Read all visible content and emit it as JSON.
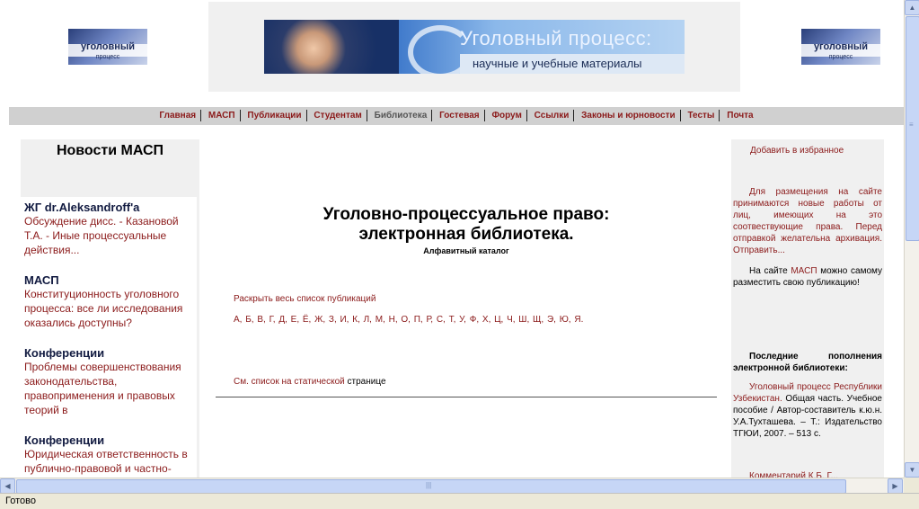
{
  "logo": {
    "text": "уголовный",
    "subtext": "процесс"
  },
  "banner": {
    "title": "Уголовный процесс:",
    "subtitle": "научные и учебные материалы"
  },
  "nav": {
    "items": [
      "Главная",
      "МАСП",
      "Публикации",
      "Студентам",
      "Библиотека",
      "Гостевая",
      "Форум",
      "Ссылки",
      "Законы и юрновости",
      "Тесты",
      "Почта"
    ],
    "current": "Библиотека"
  },
  "left": {
    "title": "Новости МАСП",
    "news": [
      {
        "head": "ЖГ dr.Aleksandroff'a",
        "text": "Обсуждение дисс. - Казановой Т.А. - Иные процессуальные действия..."
      },
      {
        "head": "МАСП",
        "text": "Конституционность уголовного процесса: все ли исследования оказались доступны?"
      },
      {
        "head": "Конференции",
        "text": "Проблемы совершенствования законодательства, правоприменения и правовых теорий в"
      },
      {
        "head": "Конференции",
        "text": "Юридическая ответственность в публично-правовой и частно-"
      }
    ]
  },
  "center": {
    "title_line1": "Уголовно-процессуальное право:",
    "title_line2": "электронная библиотека.",
    "catalog": "Алфавитный каталог",
    "expand_link": "Раскрыть весь список публикаций",
    "letters": "А, Б, В, Г, Д, Е, Ё, Ж, З, И, К, Л, М, Н, О, П, Р, С, Т, У, Ф, Х, Ц, Ч, Ш, Щ, Э, Ю, Я.",
    "static_link": "См. список на статической",
    "static_text": " странице"
  },
  "right": {
    "favorites": "Добавить в избранное",
    "submit_text": "Для размещения на сайте принимаются новые работы от лиц, имеющих на это соотвествующие права. Перед отправкой желательна архивация. Отправить...",
    "self_pre": "На сайте ",
    "self_link": "МАСП",
    "self_post": " можно самому разместить свою публикацию!",
    "recent_head": "Последние пополнения электронной библиотеки:",
    "recent_link": "Уголовный процесс Республики Узбекистан.",
    "recent_text": " Общая часть. Учебное пособие / Автор-составитель к.ю.н. У.А.Тухташева. – Т.: Издательство ТГЮИ, 2007. – 513 с.",
    "recent_next": "Комментарий К.Б. Г..."
  },
  "status": {
    "text": "Готово"
  },
  "colors": {
    "link": "#8b1a1a",
    "panel": "#f0f0f0",
    "navbar": "#d0d0d0"
  }
}
